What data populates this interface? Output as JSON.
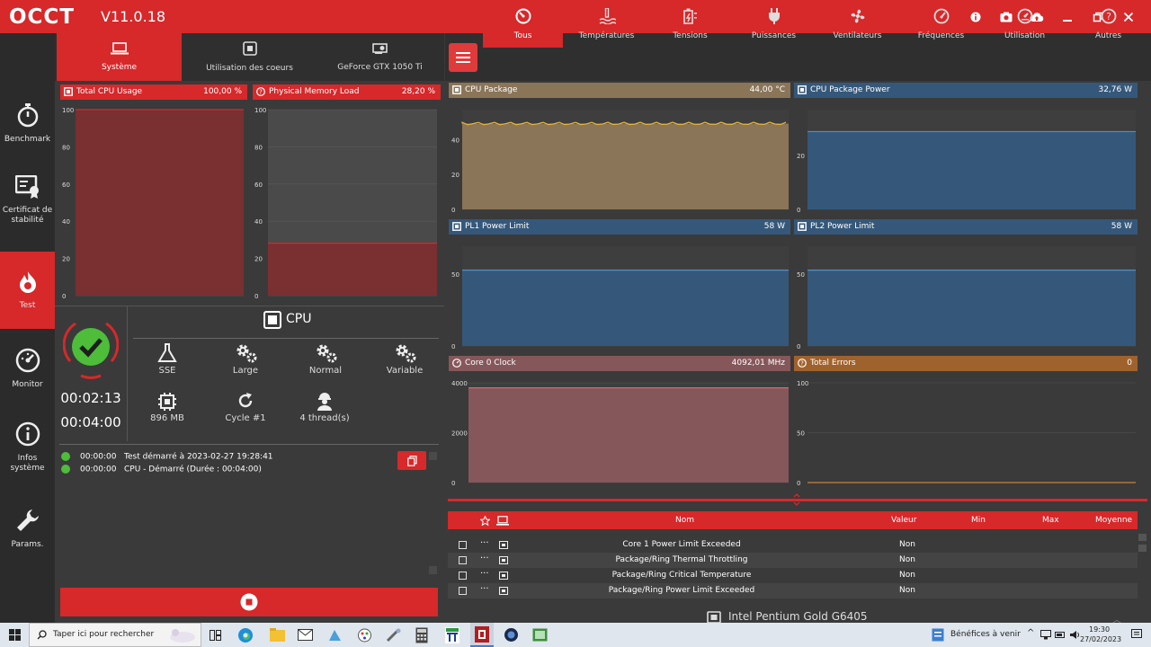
{
  "app": {
    "logo": "OCCT",
    "version": "V11.0.18"
  },
  "sidebar": [
    {
      "label": "Benchmark",
      "icon": "stopwatch-icon"
    },
    {
      "label": "Certificat de stabilité",
      "icon": "certificate-icon"
    },
    {
      "label": "Test",
      "icon": "flame-icon"
    },
    {
      "label": "Monitor",
      "icon": "gauge-icon"
    },
    {
      "label": "Infos système",
      "icon": "info-icon"
    },
    {
      "label": "Params.",
      "icon": "wrench-icon"
    }
  ],
  "left_tabs": [
    "Système",
    "Utilisation des coeurs",
    "GeForce GTX 1050 Ti"
  ],
  "left_graphs": [
    {
      "title": "Total CPU Usage",
      "value": "100,00 %",
      "ticks": [
        "100",
        "80",
        "60",
        "40",
        "20",
        "0"
      ],
      "level": 100
    },
    {
      "title": "Physical Memory Load",
      "value": "28,20 %",
      "ticks": [
        "100",
        "80",
        "60",
        "40",
        "20",
        "0"
      ],
      "level": 28.2
    }
  ],
  "test": {
    "title": "CPU",
    "elapsed": "00:02:13",
    "duration": "00:04:00",
    "options": [
      "SSE",
      "Large",
      "Normal",
      "Variable"
    ],
    "details": [
      "896 MB",
      "Cycle #1",
      "4 thread(s)"
    ]
  },
  "log": [
    {
      "time": "00:00:00",
      "text": "Test démarré à 2023-02-27 19:28:41"
    },
    {
      "time": "00:00:00",
      "text": "CPU - Démarré (Durée : 00:04:00)"
    }
  ],
  "right_tabs": [
    "Tous",
    "Températures",
    "Tensions",
    "Puissances",
    "Ventilateurs",
    "Fréquences",
    "Utilisation",
    "Autres"
  ],
  "right_graphs": [
    {
      "title": "CPU Package",
      "value": "44,00 °C",
      "ticks": [
        "40",
        "20",
        "0"
      ],
      "color": "#8a7559",
      "hdr": "#8a7559"
    },
    {
      "title": "CPU Package Power",
      "value": "32,76 W",
      "ticks": [
        "20",
        "0"
      ],
      "color": "#35587a",
      "hdr": "#35587a"
    },
    {
      "title": "PL1 Power Limit",
      "value": "58 W",
      "ticks": [
        "50",
        "0"
      ],
      "color": "#35587a",
      "hdr": "#35587a"
    },
    {
      "title": "PL2 Power Limit",
      "value": "58 W",
      "ticks": [
        "50",
        "0"
      ],
      "color": "#35587a",
      "hdr": "#35587a"
    },
    {
      "title": "Core 0 Clock",
      "value": "4092,01 MHz",
      "ticks": [
        "4000",
        "2000",
        "0"
      ],
      "color": "#86575a",
      "hdr": "#86575a"
    },
    {
      "title": "Total Errors",
      "value": "0",
      "ticks": [
        "100",
        "50",
        "0"
      ],
      "color": "#3a3a3a",
      "hdr": "#a0622d"
    }
  ],
  "table": {
    "headers": [
      "Nom",
      "Valeur",
      "Min",
      "Max",
      "Moyenne"
    ],
    "rows": [
      {
        "name": "Core 1 Power Limit Exceeded",
        "value": "Non"
      },
      {
        "name": "Package/Ring Thermal Throttling",
        "value": "Non"
      },
      {
        "name": "Package/Ring Critical Temperature",
        "value": "Non"
      },
      {
        "name": "Package/Ring Power Limit Exceeded",
        "value": "Non"
      }
    ],
    "device": "Intel Pentium Gold G6405"
  },
  "taskbar": {
    "search_placeholder": "Taper ici pour rechercher",
    "news": "Bénéfices à venir",
    "time": "19:30",
    "date": "27/02/2023"
  }
}
